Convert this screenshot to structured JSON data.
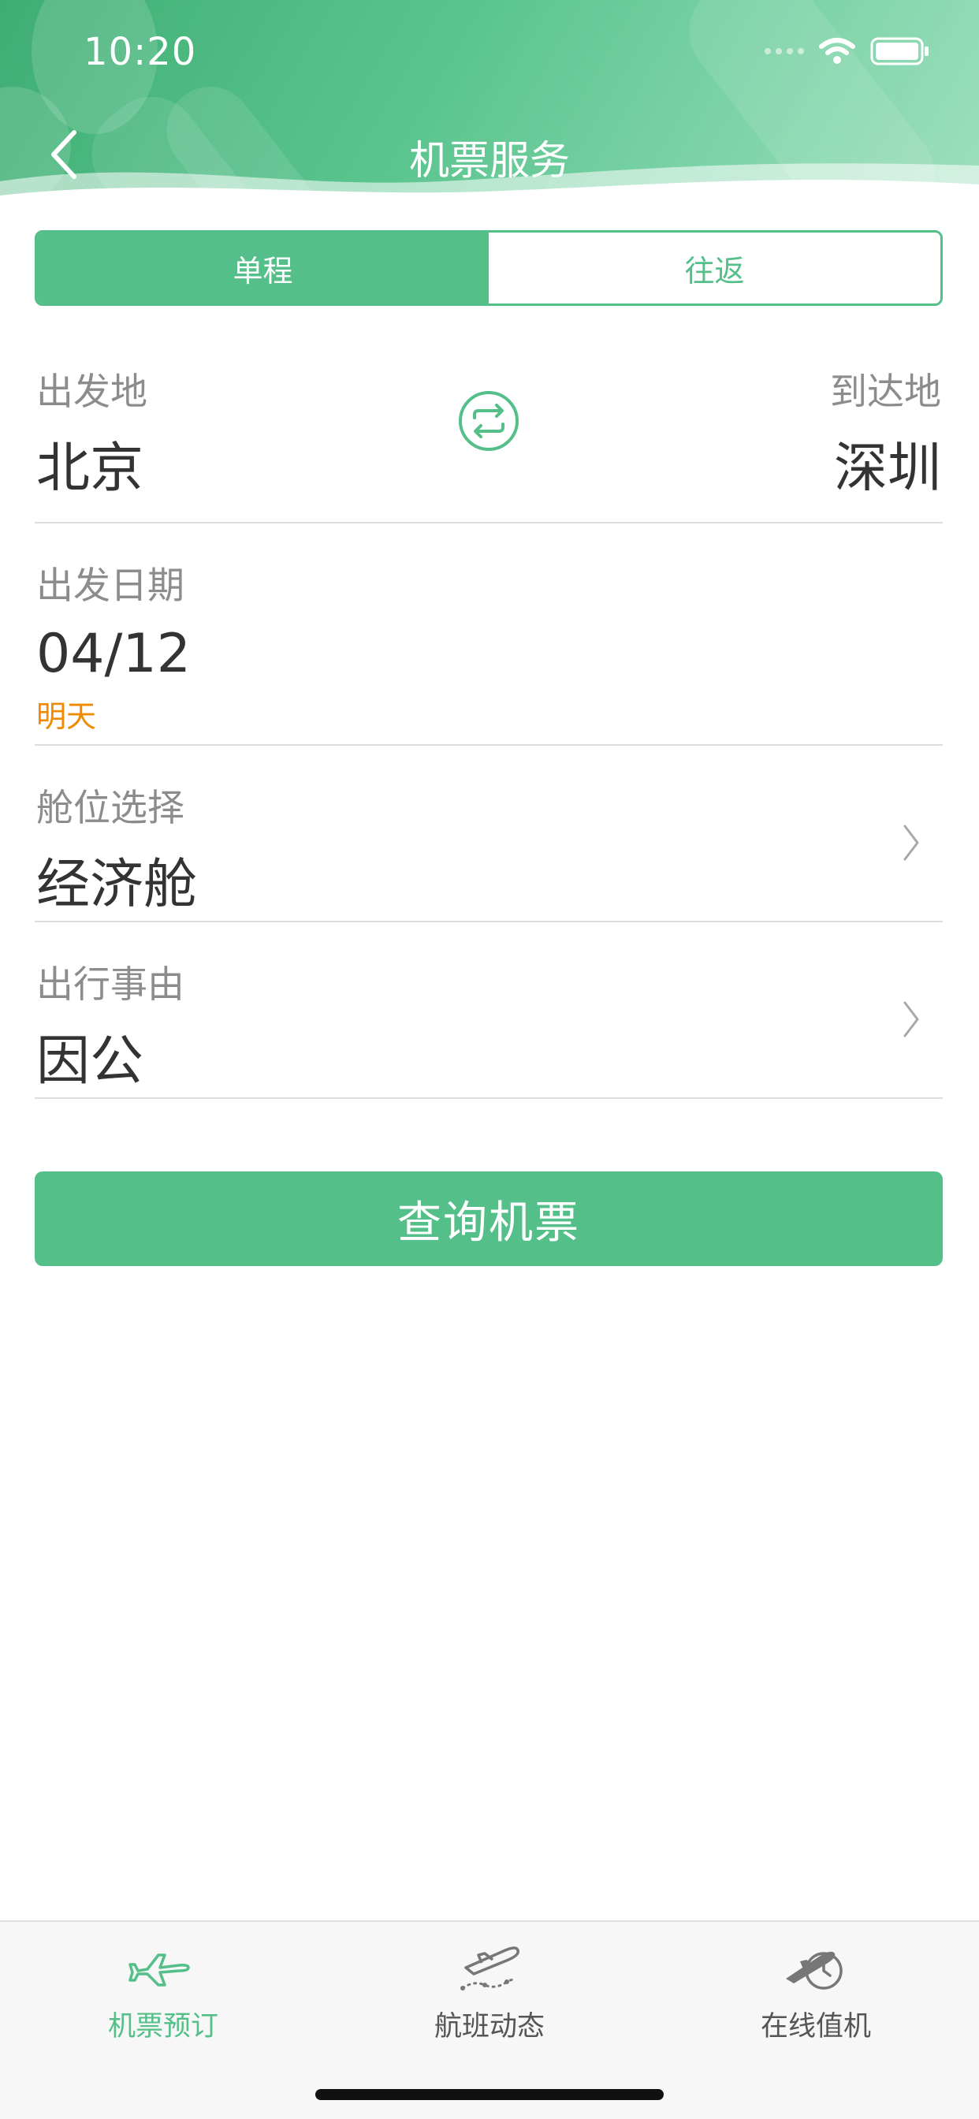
{
  "status_bar": {
    "time": "10:20"
  },
  "nav": {
    "title": "机票服务",
    "back_icon": "chevron-left-icon"
  },
  "trip_type": {
    "options": [
      "单程",
      "往返"
    ],
    "selected": "单程"
  },
  "route": {
    "origin_label": "出发地",
    "origin_value": "北京",
    "destination_label": "到达地",
    "destination_value": "深圳",
    "swap_icon": "swap-icon"
  },
  "departure_date": {
    "label": "出发日期",
    "value": "04/12",
    "hint": "明天"
  },
  "cabin": {
    "label": "舱位选择",
    "value": "经济舱"
  },
  "reason": {
    "label": "出行事由",
    "value": "因公"
  },
  "search_button": {
    "label": "查询机票"
  },
  "tabbar": {
    "items": [
      {
        "label": "机票预订",
        "icon": "airplane-icon",
        "active": true
      },
      {
        "label": "航班动态",
        "icon": "flight-takeoff-icon",
        "active": false
      },
      {
        "label": "在线值机",
        "icon": "checkin-clock-icon",
        "active": false
      }
    ]
  },
  "colors": {
    "accent": "#54bf88",
    "hint": "#f08a00",
    "text_primary": "#333333",
    "text_secondary": "#8c8c8c"
  }
}
